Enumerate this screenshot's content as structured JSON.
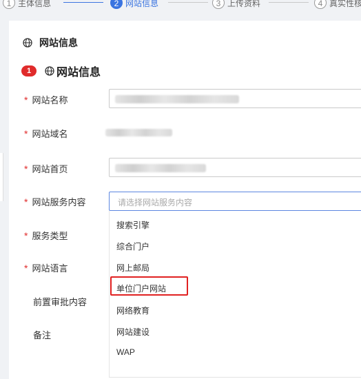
{
  "steps": [
    {
      "num": "1",
      "label": "主体信息"
    },
    {
      "num": "2",
      "label": "网站信息"
    },
    {
      "num": "3",
      "label": "上传资料"
    },
    {
      "num": "4",
      "label": "真实性核验"
    }
  ],
  "section_header": {
    "title": "网站信息"
  },
  "site_block": {
    "badge": "1",
    "title": "网站信息"
  },
  "form": {
    "site_name_label": "网站名称",
    "site_domain_label": "网站域名",
    "site_home_label": "网站首页",
    "service_content_label": "网站服务内容",
    "service_content_placeholder": "请选择网站服务内容",
    "service_type_label": "服务类型",
    "site_language_label": "网站语言",
    "pre_approval_label": "前置审批内容",
    "remarks_label": "备注",
    "required_mark": "*"
  },
  "dropdown": {
    "options": [
      "搜索引擎",
      "综合门户",
      "网上邮局",
      "单位门户网站",
      "网络教育",
      "网站建设",
      "WAP"
    ],
    "highlighted_option": "单位门户网站"
  },
  "colors": {
    "accent": "#3a74e0",
    "required": "#e02b2b",
    "highlight": "#e02020"
  }
}
